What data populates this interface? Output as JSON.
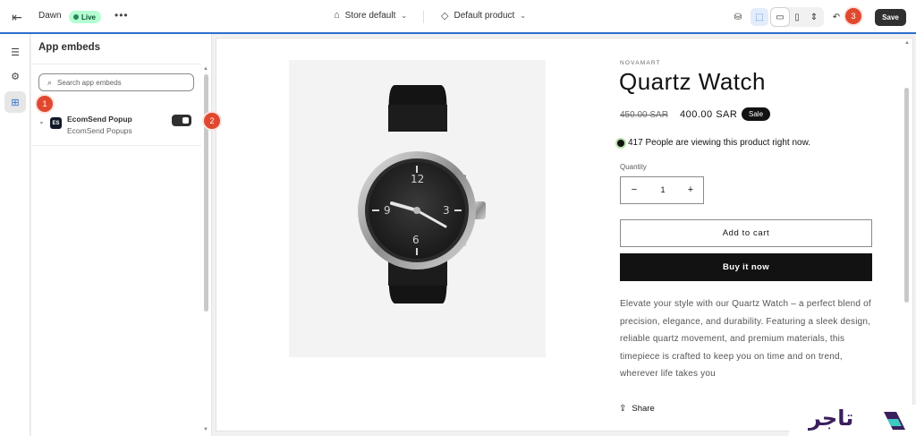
{
  "topbar": {
    "theme_name": "Dawn",
    "live_label": "Live",
    "more_label": "•••",
    "store_selector": "Store default",
    "template_selector": "Default product",
    "save_label": "Save",
    "icons": [
      "exit-icon",
      "inspector-icon",
      "select-element-icon",
      "desktop-icon",
      "mobile-icon",
      "fullwidth-icon",
      "undo-icon"
    ]
  },
  "annotations": [
    "1",
    "2",
    "3"
  ],
  "sidebar": {
    "rail_items": [
      "sections-icon",
      "settings-icon",
      "app-embeds-icon"
    ]
  },
  "panel": {
    "title": "App embeds",
    "search_placeholder": "Search app embeds",
    "embeds": [
      {
        "logo": "ES",
        "name": "EcomSend Popup",
        "provider": "EcomSend Popups",
        "enabled": true
      }
    ]
  },
  "product": {
    "vendor": "NOVAMART",
    "title": "Quartz Watch",
    "price_old": "450.00 SAR",
    "price_new": "400.00 SAR",
    "sale_badge": "Sale",
    "viewers_text": "417 People are viewing this product right now.",
    "quantity_label": "Quantity",
    "quantity_value": "1",
    "minus": "−",
    "plus": "+",
    "add_to_cart": "Add to cart",
    "buy_now": "Buy it now",
    "description": "Elevate your style with our Quartz Watch – a perfect blend of precision, elegance, and durability. Featuring a sleek design, reliable quartz movement, and premium materials, this timepiece is crafted to keep you on time and on trend, wherever life takes you",
    "share_label": "Share"
  },
  "watermark": {
    "text": "تاجر"
  },
  "colors": {
    "accent": "#2c6ecb",
    "annotation": "#e0492f",
    "dark": "#303030",
    "live": "#b4fed2"
  }
}
